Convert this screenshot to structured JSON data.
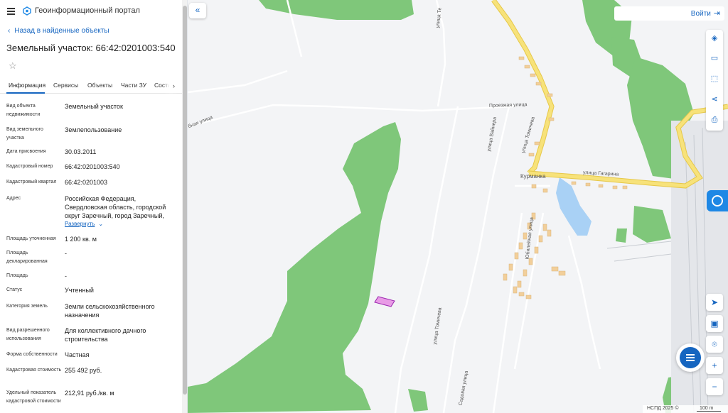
{
  "app": {
    "portal_name": "Геоинформационный портал"
  },
  "sidebar": {
    "back_label": "Назад в найденные объекты",
    "title": "Земельный участок: 66:42:0201003:540",
    "tabs": [
      {
        "label": "Информация"
      },
      {
        "label": "Сервисы"
      },
      {
        "label": "Объекты"
      },
      {
        "label": "Части ЗУ"
      },
      {
        "label": "Соста"
      }
    ],
    "fields": [
      {
        "label": "Вид объекта недвижимости",
        "value": "Земельный участок"
      },
      {
        "label": "Вид земельного участка",
        "value": "Землепользование"
      },
      {
        "label": "Дата присвоения",
        "value": "30.03.2011"
      },
      {
        "label": "Кадастровый номер",
        "value": "66:42:0201003:540"
      },
      {
        "label": "Кадастровый квартал",
        "value": "66:42:0201003"
      },
      {
        "label": "Адрес",
        "value": "Российская Федерация, Свердловская область, городской округ Заречный, город Заречный,"
      },
      {
        "label": "Площадь уточненная",
        "value": "1 200 кв. м"
      },
      {
        "label": "Площадь декларированная",
        "value": "-"
      },
      {
        "label": "Площадь",
        "value": "-"
      },
      {
        "label": "Статус",
        "value": "Учтенный"
      },
      {
        "label": "Категория земель",
        "value": "Земли сельскохозяйственного назначения"
      },
      {
        "label": "Вид разрешенного использования",
        "value": "Для коллективного дачного строительства"
      },
      {
        "label": "Форма собственности",
        "value": "Частная"
      },
      {
        "label": "Кадастровая стоимость",
        "value": "255 492 руб."
      },
      {
        "label": "Удельный показатель кадастровой стоимости",
        "value": "212,91 руб./кв. м"
      }
    ],
    "expand_label": "Развернуть"
  },
  "header": {
    "login_label": "Войти"
  },
  "map": {
    "streets": {
      "klubnaya": "Клубная улица",
      "proezzhaya": "Проезжая улица",
      "tomicheva_north": "улица Томичева",
      "vaynera": "улица Вайнера",
      "gagarina": "улица Гагарина",
      "kurmanka": "Курманка",
      "yubileynaya": "Юбилейная улица",
      "tomicheva_south": "улица Томичева",
      "sadovaya": "Садовая улица",
      "top": "улица Те"
    },
    "footer": {
      "copyright": "НСПД 2025 ©",
      "scale": "100 m"
    },
    "colors": {
      "forest": "#7fc77a",
      "road": "#f7e27a",
      "road_edge": "#e6c84a",
      "water": "#a9d1f5",
      "building": "#f2cf9a",
      "parcel": "#e89be6",
      "accent": "#1565c0"
    }
  }
}
